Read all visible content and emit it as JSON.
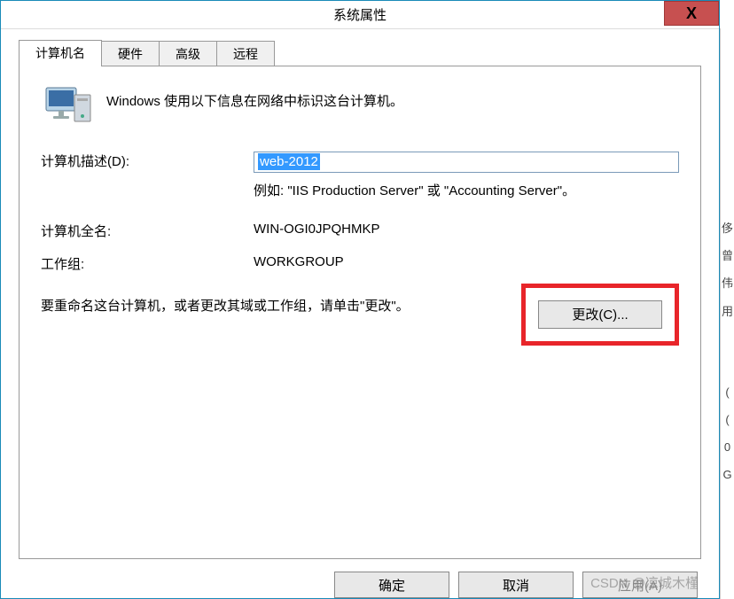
{
  "window": {
    "title": "系统属性",
    "close_glyph": "X"
  },
  "tabs": [
    {
      "label": "计算机名",
      "active": true
    },
    {
      "label": "硬件",
      "active": false
    },
    {
      "label": "高级",
      "active": false
    },
    {
      "label": "远程",
      "active": false
    }
  ],
  "intro": "Windows 使用以下信息在网络中标识这台计算机。",
  "fields": {
    "description_label": "计算机描述(D):",
    "description_value": "web-2012",
    "example": "例如: \"IIS Production Server\" 或 \"Accounting Server\"。",
    "fullname_label": "计算机全名:",
    "fullname_value": "WIN-OGI0JPQHMKP",
    "workgroup_label": "工作组:",
    "workgroup_value": "WORKGROUP"
  },
  "rename": {
    "text": "要重命名这台计算机，或者更改其域或工作组，请单击\"更改\"。",
    "button": "更改(C)..."
  },
  "footer": {
    "ok": "确定",
    "cancel": "取消",
    "apply": "应用(A)"
  },
  "watermark": "CSDN @凉城木槿",
  "icon_name": "computer-icon"
}
